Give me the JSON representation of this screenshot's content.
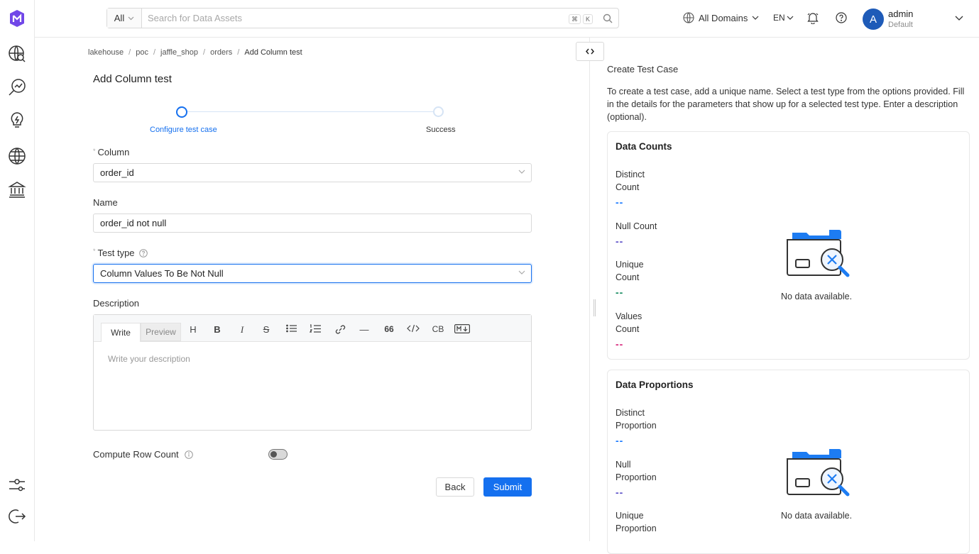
{
  "topbar": {
    "search_scope": "All",
    "search_placeholder": "Search for Data Assets",
    "shortcut_keys": [
      "⌘",
      "K"
    ],
    "domains_label": "All Domains",
    "language": "EN",
    "user": {
      "initial": "A",
      "name": "admin",
      "role": "Default"
    }
  },
  "sidebar": {
    "items": [
      {
        "icon": "explore-icon"
      },
      {
        "icon": "observability-icon"
      },
      {
        "icon": "insights-icon"
      },
      {
        "icon": "domains-icon"
      },
      {
        "icon": "governance-icon"
      }
    ],
    "bottom": [
      {
        "icon": "settings-icon"
      },
      {
        "icon": "logout-icon"
      }
    ]
  },
  "breadcrumb": [
    "lakehouse",
    "poc",
    "jaffle_shop",
    "orders",
    "Add Column test"
  ],
  "page_title": "Add Column test",
  "steps": [
    {
      "label": "Configure test case",
      "active": true
    },
    {
      "label": "Success",
      "active": false
    }
  ],
  "form": {
    "column_label": "Column",
    "column_value": "order_id",
    "name_label": "Name",
    "name_value": "order_id not null",
    "test_type_label": "Test type",
    "test_type_value": "Column Values To Be Not Null",
    "description_label": "Description",
    "editor": {
      "tab_write": "Write",
      "tab_preview": "Preview",
      "tools": [
        "H",
        "bold",
        "italic",
        "strikethrough",
        "bullet-list",
        "numbered-list",
        "link",
        "hr",
        "quote",
        "code",
        "CB",
        "markdown"
      ],
      "cb_label": "CB",
      "placeholder": "Write your description"
    },
    "row_count_label": "Compute Row Count",
    "row_count_enabled": false,
    "back_label": "Back",
    "submit_label": "Submit"
  },
  "right_panel": {
    "title": "Create Test Case",
    "description": "To create a test case, add a unique name. Select a test type from the options provided. Fill in the details for the parameters that show up for a selected test type. Enter a description (optional).",
    "cards": [
      {
        "title": "Data Counts",
        "metrics": [
          {
            "label": "Distinct Count",
            "value": "--",
            "color": "#1677ff"
          },
          {
            "label": "Null Count",
            "value": "--",
            "color": "#5b4fc7"
          },
          {
            "label": "Unique Count",
            "value": "--",
            "color": "#138a5e"
          },
          {
            "label": "Values Count",
            "value": "--",
            "color": "#d6237a"
          }
        ],
        "no_data": "No data available."
      },
      {
        "title": "Data Proportions",
        "metrics": [
          {
            "label": "Distinct Proportion",
            "value": "--",
            "color": "#1677ff"
          },
          {
            "label": "Null Proportion",
            "value": "--",
            "color": "#5b4fc7"
          },
          {
            "label": "Unique Proportion",
            "value": "",
            "color": "#138a5e"
          }
        ],
        "no_data": "No data available."
      }
    ]
  },
  "colors": {
    "primary": "#1570ef",
    "brand": "#7147e8"
  }
}
